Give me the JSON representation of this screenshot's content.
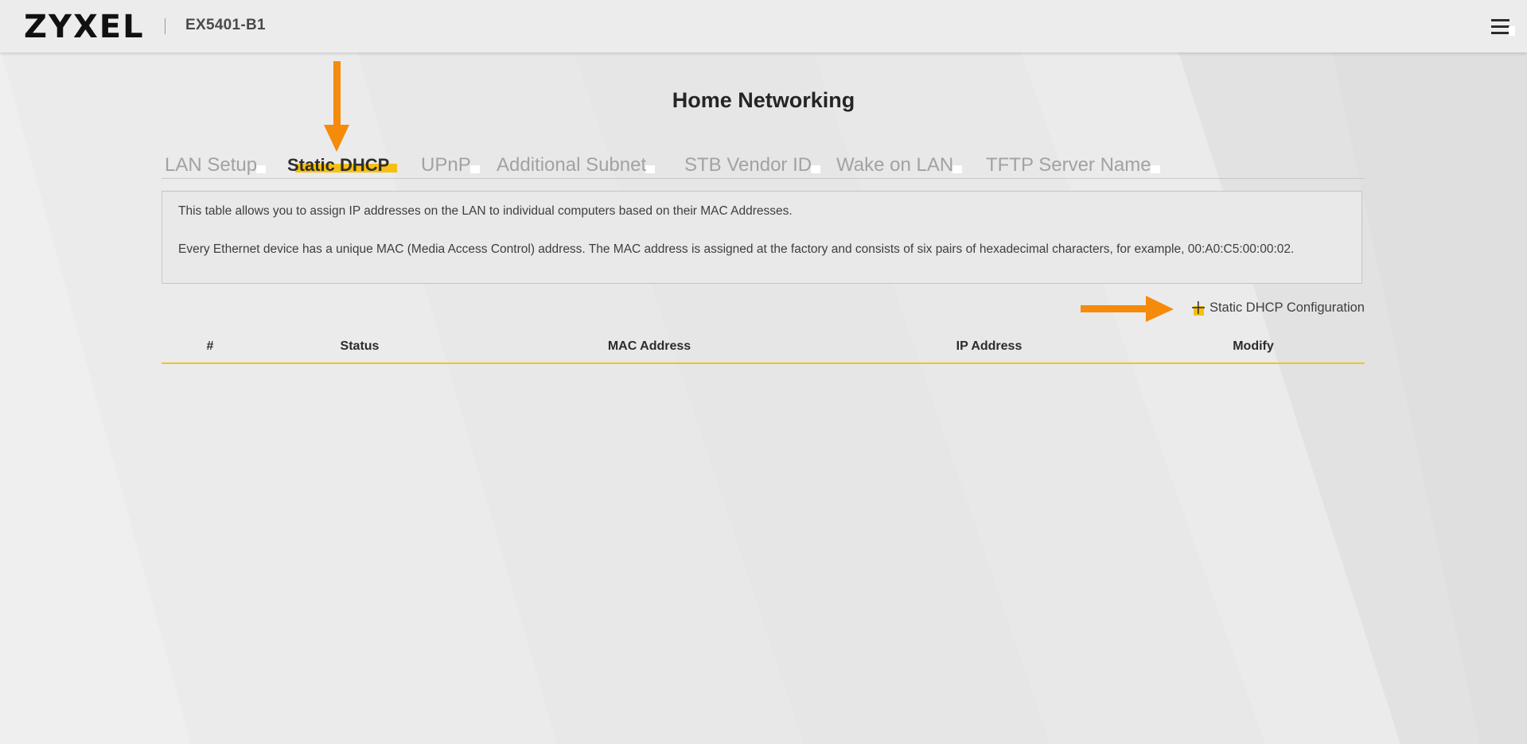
{
  "header": {
    "brand": "ZYXEL",
    "model": "EX5401-B1",
    "menu_icon": "hamburger-menu-icon"
  },
  "page": {
    "title": "Home Networking"
  },
  "tabs": [
    {
      "label": "LAN Setup",
      "active": false
    },
    {
      "label": "Static DHCP",
      "active": true
    },
    {
      "label": "UPnP",
      "active": false
    },
    {
      "label": "Additional Subnet",
      "active": false
    },
    {
      "label": "STB Vendor ID",
      "active": false
    },
    {
      "label": "Wake on LAN",
      "active": false
    },
    {
      "label": "TFTP Server Name",
      "active": false
    }
  ],
  "info": {
    "line1": "This table allows you to assign IP addresses on the LAN to individual computers based on their MAC Addresses.",
    "line2": "Every Ethernet device has a unique MAC (Media Access Control) address. The MAC address is assigned at the factory and consists of six pairs of hexadecimal characters, for example, 00:A0:C5:00:00:02."
  },
  "actions": {
    "add_label": "Static DHCP Configuration",
    "add_icon": "plus-icon"
  },
  "table": {
    "columns": [
      "#",
      "Status",
      "MAC Address",
      "IP Address",
      "Modify"
    ],
    "rows": []
  },
  "colors": {
    "accent": "#f6c012",
    "annotation_arrow": "#f58a0b",
    "background": "#ebebeb"
  }
}
